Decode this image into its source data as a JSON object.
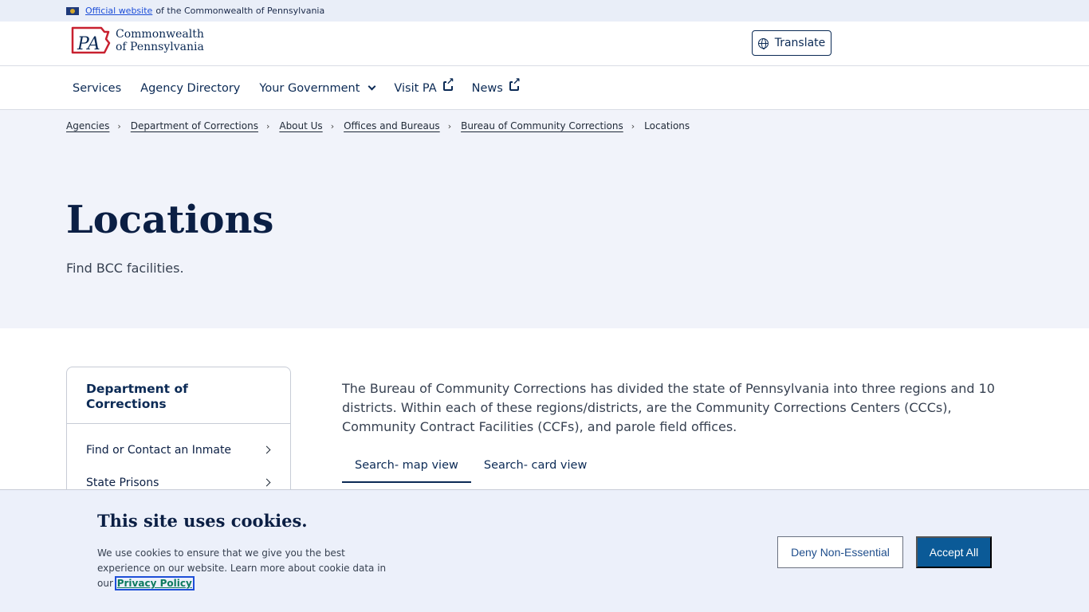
{
  "official_bar": {
    "link": "Official website",
    "text": "of the Commonwealth of Pennsylvania"
  },
  "header": {
    "logo_mark": "PA",
    "logo_line1": "Commonwealth",
    "logo_line2": "of Pennsylvania",
    "translate_label": "Translate"
  },
  "nav": {
    "items": [
      {
        "label": "Services"
      },
      {
        "label": "Agency Directory"
      },
      {
        "label": "Your Government",
        "icon": "chevron-down-icon"
      },
      {
        "label": "Visit PA",
        "icon": "external-link-icon"
      },
      {
        "label": "News",
        "icon": "external-link-icon"
      }
    ]
  },
  "breadcrumb": {
    "items": [
      "Agencies",
      "Department of Corrections",
      "About Us",
      "Offices and Bureaus",
      "Bureau of Community Corrections"
    ],
    "current": "Locations"
  },
  "hero": {
    "title": "Locations",
    "subtitle": "Find BCC facilities."
  },
  "sidebar": {
    "title": "Department of Corrections",
    "items": [
      {
        "label": "Find or Contact an Inmate"
      },
      {
        "label": "State Prisons"
      }
    ]
  },
  "main": {
    "intro": "The Bureau of Community Corrections has divided the state of Pennsylvania into three regions and 10 districts. Within each of these regions/districts, are the Community Corrections Centers (CCCs), Community Contract Facilities (CCFs), and parole field offices.",
    "tabs": [
      {
        "label": "Search- map view",
        "active": true
      },
      {
        "label": "Search- card view",
        "active": false
      }
    ]
  },
  "cookie": {
    "title": "This site uses cookies.",
    "text": "We use cookies to ensure that we give you the best experience on our website. Learn more about cookie data in our",
    "link": "Privacy Policy",
    "deny_label": "Deny Non-Essential",
    "accept_label": "Accept All"
  }
}
